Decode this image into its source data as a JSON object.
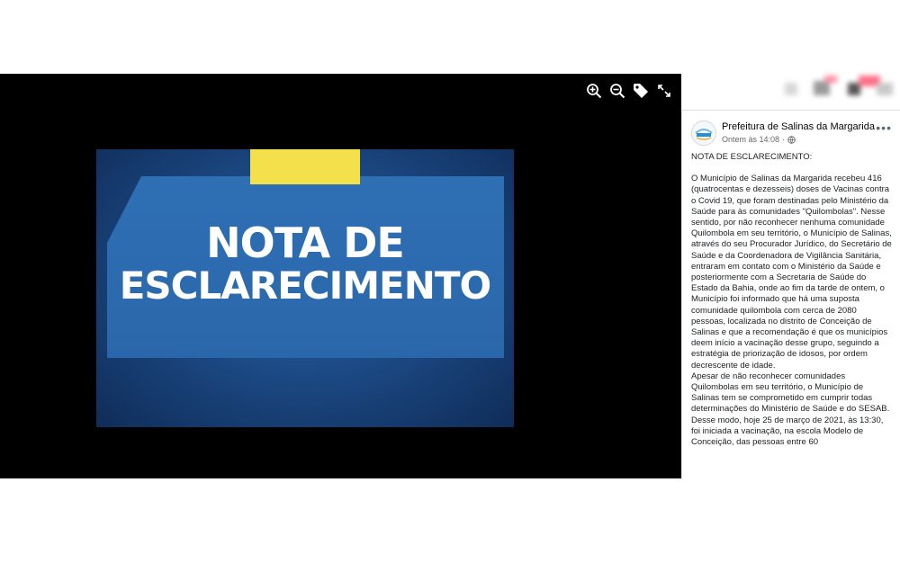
{
  "viewer": {
    "tools": [
      {
        "name": "zoom-in-icon"
      },
      {
        "name": "zoom-out-icon"
      },
      {
        "name": "tag-icon"
      },
      {
        "name": "fullscreen-icon"
      }
    ],
    "image": {
      "headline_line1": "NOTA DE",
      "headline_line2": "ESCLARECIMENTO",
      "colors": {
        "tab": "#f3e04a",
        "card": "#2f6fb4",
        "background": "#1c4a85"
      }
    }
  },
  "post": {
    "page_name": "Prefeitura de Salinas da Margarida",
    "timestamp": "Ontem às 14:08",
    "privacy_icon": "globe-icon",
    "more_icon": "more-options-icon",
    "title": "NOTA DE ESCLARECIMENTO:",
    "body": "O Município de Salinas da Margarida recebeu 416 (quatrocentas e dezesseis) doses de Vacinas contra o Covid 19, que foram destinadas pelo Ministério da Saúde para às comunidades \"Quilombolas\". Nesse sentido, por não reconhecer nenhuma comunidade Quilombola em seu território, o Município de Salinas, através do seu Procurador Jurídico, do Secretário de Saúde e da Coordenadora de Vigilância Sanitária, entraram em contato com o Ministério da Saúde e posteriormente com a Secretaria de Saúde do Estado da Bahia, onde ao fim da tarde de ontem, o Município foi informado que há uma suposta comunidade quilombola com cerca de 2080 pessoas, localizada no distrito de Conceição de Salinas e que a recomendação é que os municípios deem início a vacinação desse grupo, seguindo a estratégia de priorização de idosos, por ordem decrescente de idade.",
    "body2": "Apesar de não reconhecer comunidades Quilombolas em seu território, o Município de Salinas tem se comprometido em cumprir todas determinações do Ministério de Saúde e do SESAB. Desse modo, hoje 25 de março de 2021, às 13:30, foi iniciada a vacinação, na escola Modelo de Conceição, das pessoas entre 60"
  }
}
